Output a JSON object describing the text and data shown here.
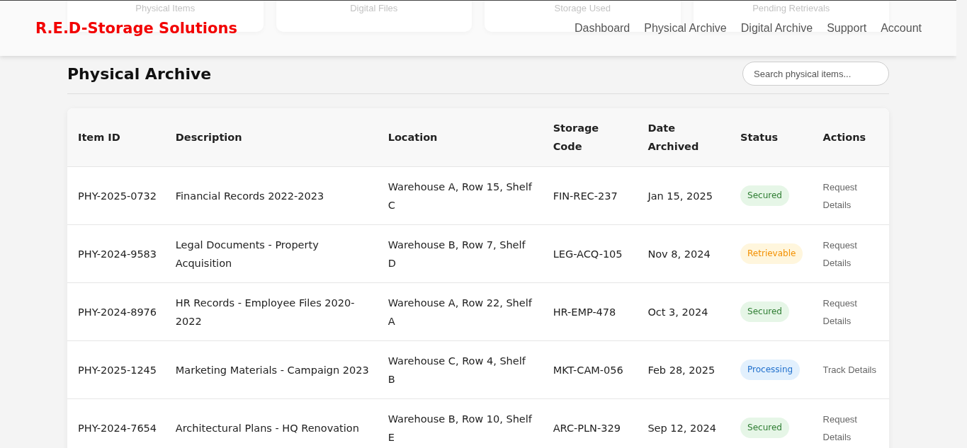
{
  "stats": [
    {
      "label": "Physical Items"
    },
    {
      "label": "Digital Files"
    },
    {
      "label": "Storage Used"
    },
    {
      "label": "Pending Retrievals"
    }
  ],
  "header": {
    "logo": "R.E.D-Storage Solutions",
    "nav": [
      {
        "label": "Dashboard"
      },
      {
        "label": "Physical Archive"
      },
      {
        "label": "Digital Archive"
      },
      {
        "label": "Support"
      },
      {
        "label": "Account"
      }
    ]
  },
  "page": {
    "title": "Physical Archive",
    "search": {
      "placeholder": "Search physical items..."
    }
  },
  "table": {
    "columns": [
      "Item ID",
      "Description",
      "Location",
      "Storage Code",
      "Date Archived",
      "Status",
      "Actions"
    ],
    "rows": [
      {
        "id": "PHY-2025-0732",
        "description": "Financial Records 2022-2023",
        "location": "Warehouse A, Row 15, Shelf C",
        "code": "FIN-REC-237",
        "date": "Jan 15, 2025",
        "status": {
          "label": "Secured",
          "kind": "secured"
        },
        "action": "Request Details"
      },
      {
        "id": "PHY-2024-9583",
        "description": "Legal Documents - Property Acquisition",
        "location": "Warehouse B, Row 7, Shelf D",
        "code": "LEG-ACQ-105",
        "date": "Nov 8, 2024",
        "status": {
          "label": "Retrievable",
          "kind": "retrievable"
        },
        "action": "Request Details"
      },
      {
        "id": "PHY-2024-8976",
        "description": "HR Records - Employee Files 2020-2022",
        "location": "Warehouse A, Row 22, Shelf A",
        "code": "HR-EMP-478",
        "date": "Oct 3, 2024",
        "status": {
          "label": "Secured",
          "kind": "secured"
        },
        "action": "Request Details"
      },
      {
        "id": "PHY-2025-1245",
        "description": "Marketing Materials - Campaign 2023",
        "location": "Warehouse C, Row 4, Shelf B",
        "code": "MKT-CAM-056",
        "date": "Feb 28, 2025",
        "status": {
          "label": "Processing",
          "kind": "processing"
        },
        "action": "Track Details"
      },
      {
        "id": "PHY-2024-7654",
        "description": "Architectural Plans - HQ Renovation",
        "location": "Warehouse B, Row 10, Shelf E",
        "code": "ARC-PLN-329",
        "date": "Sep 12, 2024",
        "status": {
          "label": "Secured",
          "kind": "secured"
        },
        "action": "Request Details"
      }
    ]
  }
}
